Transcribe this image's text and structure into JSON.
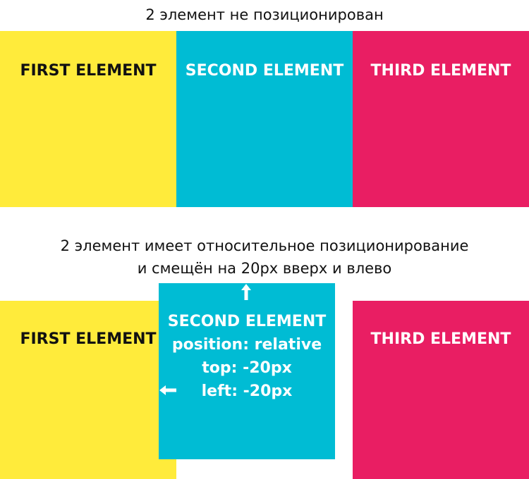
{
  "captions": {
    "top": "2 элемент не позиционирован",
    "bottom_line1": "2 элемент имеет относительное позиционирование",
    "bottom_line2": "и смещён на 20px вверх и влево"
  },
  "row1": {
    "first": "FIRST ELEMENT",
    "second": "SECOND ELEMENT",
    "third": "THIRD ELEMENT"
  },
  "row2": {
    "first": "FIRST ELEMENT",
    "second_lines": [
      "SECOND ELEMENT",
      "position: relative",
      "top: -20px",
      "left: -20px"
    ],
    "third": "THIRD ELEMENT"
  },
  "colors": {
    "yellow": "#ffeb3b",
    "cyan": "#00bcd4",
    "pink": "#e91e63"
  },
  "icons": {
    "up": "arrow-up-icon",
    "left": "arrow-left-icon"
  }
}
